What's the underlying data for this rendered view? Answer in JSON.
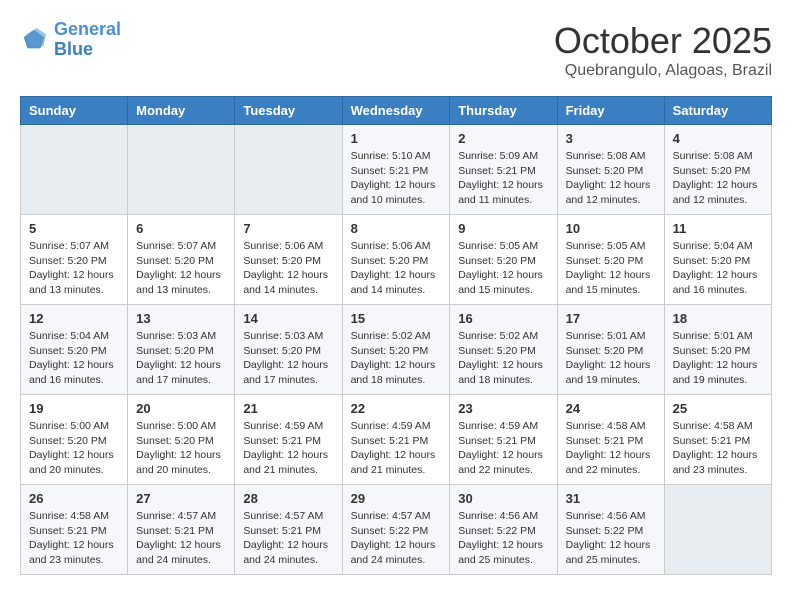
{
  "logo": {
    "line1": "General",
    "line2": "Blue"
  },
  "title": "October 2025",
  "subtitle": "Quebrangulo, Alagoas, Brazil",
  "days_of_week": [
    "Sunday",
    "Monday",
    "Tuesday",
    "Wednesday",
    "Thursday",
    "Friday",
    "Saturday"
  ],
  "weeks": [
    [
      {
        "day": "",
        "info": ""
      },
      {
        "day": "",
        "info": ""
      },
      {
        "day": "",
        "info": ""
      },
      {
        "day": "1",
        "info": "Sunrise: 5:10 AM\nSunset: 5:21 PM\nDaylight: 12 hours\nand 10 minutes."
      },
      {
        "day": "2",
        "info": "Sunrise: 5:09 AM\nSunset: 5:21 PM\nDaylight: 12 hours\nand 11 minutes."
      },
      {
        "day": "3",
        "info": "Sunrise: 5:08 AM\nSunset: 5:20 PM\nDaylight: 12 hours\nand 12 minutes."
      },
      {
        "day": "4",
        "info": "Sunrise: 5:08 AM\nSunset: 5:20 PM\nDaylight: 12 hours\nand 12 minutes."
      }
    ],
    [
      {
        "day": "5",
        "info": "Sunrise: 5:07 AM\nSunset: 5:20 PM\nDaylight: 12 hours\nand 13 minutes."
      },
      {
        "day": "6",
        "info": "Sunrise: 5:07 AM\nSunset: 5:20 PM\nDaylight: 12 hours\nand 13 minutes."
      },
      {
        "day": "7",
        "info": "Sunrise: 5:06 AM\nSunset: 5:20 PM\nDaylight: 12 hours\nand 14 minutes."
      },
      {
        "day": "8",
        "info": "Sunrise: 5:06 AM\nSunset: 5:20 PM\nDaylight: 12 hours\nand 14 minutes."
      },
      {
        "day": "9",
        "info": "Sunrise: 5:05 AM\nSunset: 5:20 PM\nDaylight: 12 hours\nand 15 minutes."
      },
      {
        "day": "10",
        "info": "Sunrise: 5:05 AM\nSunset: 5:20 PM\nDaylight: 12 hours\nand 15 minutes."
      },
      {
        "day": "11",
        "info": "Sunrise: 5:04 AM\nSunset: 5:20 PM\nDaylight: 12 hours\nand 16 minutes."
      }
    ],
    [
      {
        "day": "12",
        "info": "Sunrise: 5:04 AM\nSunset: 5:20 PM\nDaylight: 12 hours\nand 16 minutes."
      },
      {
        "day": "13",
        "info": "Sunrise: 5:03 AM\nSunset: 5:20 PM\nDaylight: 12 hours\nand 17 minutes."
      },
      {
        "day": "14",
        "info": "Sunrise: 5:03 AM\nSunset: 5:20 PM\nDaylight: 12 hours\nand 17 minutes."
      },
      {
        "day": "15",
        "info": "Sunrise: 5:02 AM\nSunset: 5:20 PM\nDaylight: 12 hours\nand 18 minutes."
      },
      {
        "day": "16",
        "info": "Sunrise: 5:02 AM\nSunset: 5:20 PM\nDaylight: 12 hours\nand 18 minutes."
      },
      {
        "day": "17",
        "info": "Sunrise: 5:01 AM\nSunset: 5:20 PM\nDaylight: 12 hours\nand 19 minutes."
      },
      {
        "day": "18",
        "info": "Sunrise: 5:01 AM\nSunset: 5:20 PM\nDaylight: 12 hours\nand 19 minutes."
      }
    ],
    [
      {
        "day": "19",
        "info": "Sunrise: 5:00 AM\nSunset: 5:20 PM\nDaylight: 12 hours\nand 20 minutes."
      },
      {
        "day": "20",
        "info": "Sunrise: 5:00 AM\nSunset: 5:20 PM\nDaylight: 12 hours\nand 20 minutes."
      },
      {
        "day": "21",
        "info": "Sunrise: 4:59 AM\nSunset: 5:21 PM\nDaylight: 12 hours\nand 21 minutes."
      },
      {
        "day": "22",
        "info": "Sunrise: 4:59 AM\nSunset: 5:21 PM\nDaylight: 12 hours\nand 21 minutes."
      },
      {
        "day": "23",
        "info": "Sunrise: 4:59 AM\nSunset: 5:21 PM\nDaylight: 12 hours\nand 22 minutes."
      },
      {
        "day": "24",
        "info": "Sunrise: 4:58 AM\nSunset: 5:21 PM\nDaylight: 12 hours\nand 22 minutes."
      },
      {
        "day": "25",
        "info": "Sunrise: 4:58 AM\nSunset: 5:21 PM\nDaylight: 12 hours\nand 23 minutes."
      }
    ],
    [
      {
        "day": "26",
        "info": "Sunrise: 4:58 AM\nSunset: 5:21 PM\nDaylight: 12 hours\nand 23 minutes."
      },
      {
        "day": "27",
        "info": "Sunrise: 4:57 AM\nSunset: 5:21 PM\nDaylight: 12 hours\nand 24 minutes."
      },
      {
        "day": "28",
        "info": "Sunrise: 4:57 AM\nSunset: 5:21 PM\nDaylight: 12 hours\nand 24 minutes."
      },
      {
        "day": "29",
        "info": "Sunrise: 4:57 AM\nSunset: 5:22 PM\nDaylight: 12 hours\nand 24 minutes."
      },
      {
        "day": "30",
        "info": "Sunrise: 4:56 AM\nSunset: 5:22 PM\nDaylight: 12 hours\nand 25 minutes."
      },
      {
        "day": "31",
        "info": "Sunrise: 4:56 AM\nSunset: 5:22 PM\nDaylight: 12 hours\nand 25 minutes."
      },
      {
        "day": "",
        "info": ""
      }
    ]
  ]
}
